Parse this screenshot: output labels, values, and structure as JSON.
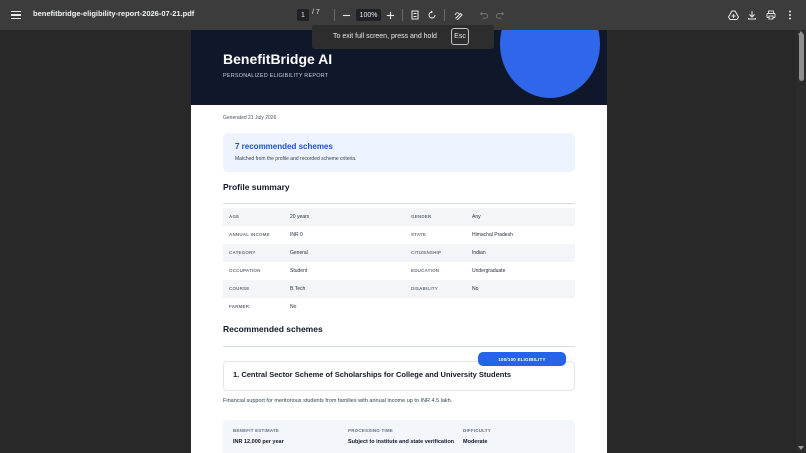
{
  "viewer": {
    "filename": "benefitbridge-eligibility-report-2026-07-21.pdf",
    "page_current": "1",
    "page_total": "/ 7",
    "zoom": "100%",
    "icons": {
      "menu": "menu-icon",
      "zoom_out": "minus-icon",
      "zoom_in": "plus-icon",
      "fit": "fit-page-icon",
      "rotate": "rotate-icon",
      "annotate": "draw-icon",
      "undo": "undo-icon",
      "redo": "redo-icon",
      "save_drive": "drive-icon",
      "download": "download-icon",
      "print": "print-icon",
      "more": "more-vertical-icon"
    }
  },
  "fullscreen_tip": {
    "text": "To exit full screen, press and hold",
    "key": "Esc"
  },
  "report": {
    "brand": "BenefitBridge AI",
    "subtitle": "PERSONALIZED ELIGIBILITY REPORT",
    "generated": "Generated 21 July 2026",
    "summary_title": "7 recommended schemes",
    "summary_sub": "Matched from the profile and recorded scheme criteria.",
    "profile_heading": "Profile summary",
    "profile_rows": [
      {
        "l1": "AGE",
        "v1": "20 years",
        "l2": "GENDER",
        "v2": "Any"
      },
      {
        "l1": "ANNUAL INCOME",
        "v1": "INR 0",
        "l2": "STATE",
        "v2": "Himachal Pradesh"
      },
      {
        "l1": "CATEGORY",
        "v1": "General",
        "l2": "CITIZENSHIP",
        "v2": "Indian"
      },
      {
        "l1": "OCCUPATION",
        "v1": "Student",
        "l2": "EDUCATION",
        "v2": "Undergraduate"
      },
      {
        "l1": "COURSE",
        "v1": "B.Tech",
        "l2": "DISABILITY",
        "v2": "No"
      },
      {
        "l1": "FARMER",
        "v1": "No",
        "l2": "",
        "v2": ""
      }
    ],
    "recommended_heading": "Recommended schemes",
    "scheme": {
      "badge": "100/100 ELIGIBILITY",
      "title": "1. Central Sector Scheme of Scholarships for College and University Students",
      "description": "Financial support for meritorious students from families with annual income up to INR 4.5 lakh.",
      "benefit_label": "BENEFIT ESTIMATE",
      "benefit_value": "INR 12,000 per year",
      "processing_label": "PROCESSING TIME",
      "processing_value": "Subject to institute and state verification",
      "difficulty_label": "DIFFICULTY",
      "difficulty_value": "Moderate"
    }
  },
  "colors": {
    "toolbar": "#3c3c3c",
    "hero": "#0f172a",
    "accent": "#2563eb",
    "accent_text": "#1d4ed8"
  }
}
